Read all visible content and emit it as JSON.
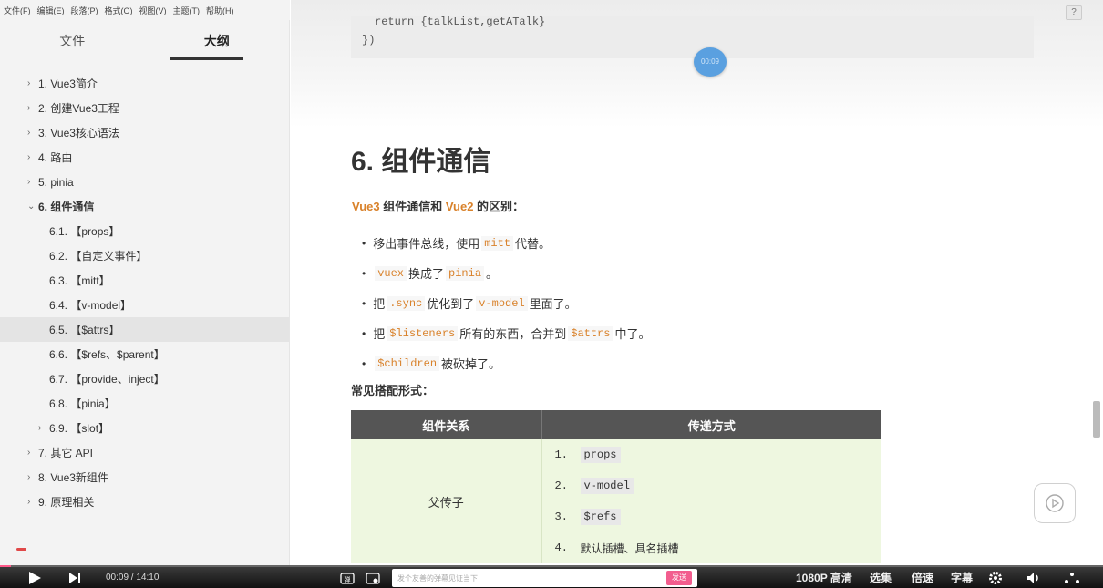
{
  "menu": [
    "文件(F)",
    "编辑(E)",
    "段落(P)",
    "格式(O)",
    "视图(V)",
    "主题(T)",
    "帮助(H)"
  ],
  "sidebar": {
    "tabs": [
      "文件",
      "大纲"
    ],
    "items": [
      {
        "label": "1. Vue3简介",
        "chevron": "›"
      },
      {
        "label": "2. 创建Vue3工程",
        "chevron": "›"
      },
      {
        "label": "3. Vue3核心语法",
        "chevron": "›"
      },
      {
        "label": "4. 路由",
        "chevron": "›"
      },
      {
        "label": "5. pinia",
        "chevron": "›"
      },
      {
        "label": "6. 组件通信",
        "chevron": "⌄"
      },
      {
        "label": "6.1. 【props】"
      },
      {
        "label": "6.2. 【自定义事件】"
      },
      {
        "label": "6.3. 【mitt】"
      },
      {
        "label": "6.4. 【v-model】"
      },
      {
        "label": "6.5. 【$attrs】"
      },
      {
        "label": "6.6. 【$refs、$parent】"
      },
      {
        "label": "6.7. 【provide、inject】"
      },
      {
        "label": "6.8. 【pinia】"
      },
      {
        "label": "6.9. 【slot】",
        "chevron": "›"
      },
      {
        "label": "7. 其它 API",
        "chevron": "›"
      },
      {
        "label": "8. Vue3新组件",
        "chevron": "›"
      },
      {
        "label": "9. 原理相关",
        "chevron": "›"
      }
    ]
  },
  "code": {
    "line1": "return {talkList,getATalk}",
    "line2": "})"
  },
  "timer_bubble": "00:09",
  "help": "?",
  "doc": {
    "heading": "6. 组件通信",
    "subtitle": {
      "a": "Vue3",
      "b": " 组件通信和 ",
      "c": "Vue2",
      "d": " 的区别："
    },
    "points": [
      {
        "pre": "移出事件总线，使用 ",
        "code": "mitt",
        "post": " 代替。"
      },
      {
        "pre": "",
        "code": "vuex",
        "mid": " 换成了 ",
        "code2": "pinia",
        "post": " 。"
      },
      {
        "pre": "把 ",
        "code": ".sync",
        "mid": " 优化到了 ",
        "code2": "v-model",
        "post": " 里面了。"
      },
      {
        "pre": "把 ",
        "code": "$listeners",
        "mid": " 所有的东西，合并到 ",
        "code2": "$attrs",
        "post": " 中了。"
      },
      {
        "pre": "",
        "code": "$children",
        "post": " 被砍掉了。"
      }
    ],
    "subtitle2": "常见搭配形式：",
    "table": {
      "headers": [
        "组件关系",
        "传递方式"
      ],
      "relation": "父传子",
      "ways": [
        {
          "n": "1.",
          "v": "props"
        },
        {
          "n": "2.",
          "v": "v-model"
        },
        {
          "n": "3.",
          "v": "$refs"
        },
        {
          "n": "4.",
          "v": "默认插槽、具名插槽"
        }
      ]
    }
  },
  "player": {
    "time": "00:09 / 14:10",
    "danmu_placeholder": "发个友善的弹幕见证当下",
    "send": "发送",
    "quality": "1080P 高清",
    "select": "选集",
    "speed": "倍速",
    "subtitle": "字幕",
    "progress_percent": 1
  }
}
